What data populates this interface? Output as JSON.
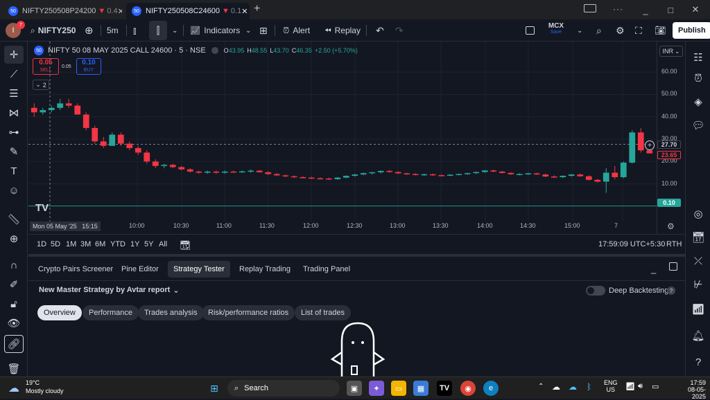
{
  "browser": {
    "tabs": [
      {
        "favicon": "50",
        "title": "NIFTY250508P24200",
        "arrow": "▼",
        "value": "0.4"
      },
      {
        "favicon": "50",
        "title": "NIFTY250508C24600",
        "arrow": "▼",
        "value": "0.1"
      }
    ],
    "new_tab": "+",
    "window_controls": [
      "_",
      "□",
      "✕"
    ]
  },
  "toolbar": {
    "avatar_letter": "I",
    "notification_count": "7",
    "symbol": "NIFTY250",
    "interval": "5m",
    "indicators_label": "Indicators",
    "alert_label": "Alert",
    "replay_label": "Replay",
    "exchange": "MCX",
    "exchange_sub": "Save",
    "publish_label": "Publish"
  },
  "legend": {
    "favicon": "50",
    "title": "NIFTY 50 08 MAY 2025 CALL 24600 · 5 · NSE",
    "ohlc": [
      {
        "k": "O",
        "v": "43.95"
      },
      {
        "k": "H",
        "v": "48.55"
      },
      {
        "k": "L",
        "v": "43.70"
      },
      {
        "k": "C",
        "v": "46.35"
      }
    ],
    "change": "+2.50 (+5.70%)",
    "sell_price": "0.05",
    "sell_label": "SELL",
    "spread": "0.05",
    "buy_price": "0.10",
    "buy_label": "BUY",
    "collapsed_count": "2",
    "currency": "INR"
  },
  "price_scale": {
    "labels": [
      "60.00",
      "50.00",
      "40.00",
      "30.00",
      "20.00",
      "10.00"
    ],
    "current_price": "27.70",
    "red_marker": "23.65",
    "bottom_marker": "0.10"
  },
  "time_axis": {
    "crosshair_label": "Mon 05 May '25   15:15",
    "labels": [
      "10:00",
      "10:30",
      "11:00",
      "11:30",
      "12:00",
      "12:30",
      "13:00",
      "13:30",
      "14:00",
      "14:30",
      "15:00",
      "7"
    ]
  },
  "range_bar": {
    "ranges": [
      "1D",
      "5D",
      "1M",
      "3M",
      "6M",
      "YTD",
      "1Y",
      "5Y",
      "All"
    ],
    "clock": "17:59:09 UTC+5:30",
    "session": "RTH"
  },
  "panel": {
    "tabs": [
      "Crypto Pairs Screener",
      "Pine Editor",
      "Strategy Tester",
      "Replay Trading",
      "Trading Panel"
    ],
    "active_tab": "Strategy Tester",
    "strategy_name": "New Master Strategy by Avtar report",
    "deep_backtesting": "Deep Backtesting",
    "subtabs": [
      "Overview",
      "Performance",
      "Trades analysis",
      "Risk/performance ratios",
      "List of trades"
    ],
    "active_subtab": "Overview"
  },
  "taskbar": {
    "temperature": "19°C",
    "weather": "Mostly cloudy",
    "search_placeholder": "Search",
    "lang": "ENG",
    "region": "US",
    "time": "17:59",
    "date": "08-05-2025"
  },
  "colors": {
    "up": "#26a69a",
    "down": "#f23645",
    "background": "#131722",
    "accent": "#2962ff"
  },
  "chart_data": {
    "type": "candlestick",
    "ylim": [
      0,
      65
    ],
    "candles": [
      {
        "o": 44,
        "h": 46,
        "l": 40,
        "c": 42
      },
      {
        "o": 42,
        "h": 44,
        "l": 41,
        "c": 43
      },
      {
        "o": 43,
        "h": 45,
        "l": 42,
        "c": 44
      },
      {
        "o": 44,
        "h": 48,
        "l": 43,
        "c": 46
      },
      {
        "o": 46,
        "h": 48,
        "l": 44,
        "c": 45
      },
      {
        "o": 45,
        "h": 46,
        "l": 41,
        "c": 41
      },
      {
        "o": 41,
        "h": 42,
        "l": 34,
        "c": 35
      },
      {
        "o": 35,
        "h": 36,
        "l": 28,
        "c": 29
      },
      {
        "o": 29,
        "h": 31,
        "l": 26,
        "c": 27
      },
      {
        "o": 27,
        "h": 33,
        "l": 27,
        "c": 32
      },
      {
        "o": 32,
        "h": 33,
        "l": 27,
        "c": 28
      },
      {
        "o": 28,
        "h": 29,
        "l": 25,
        "c": 26
      },
      {
        "o": 26,
        "h": 27,
        "l": 23,
        "c": 24
      },
      {
        "o": 24,
        "h": 25,
        "l": 19,
        "c": 20
      },
      {
        "o": 20,
        "h": 21,
        "l": 17,
        "c": 18
      },
      {
        "o": 18,
        "h": 19,
        "l": 17,
        "c": 18.5
      },
      {
        "o": 18.5,
        "h": 19,
        "l": 17,
        "c": 17.5
      },
      {
        "o": 17.5,
        "h": 18,
        "l": 16,
        "c": 16.5
      },
      {
        "o": 16.5,
        "h": 17,
        "l": 15,
        "c": 15.5
      },
      {
        "o": 15.5,
        "h": 16,
        "l": 14.5,
        "c": 15
      },
      {
        "o": 15,
        "h": 16,
        "l": 14.5,
        "c": 15.5
      },
      {
        "o": 15.5,
        "h": 16,
        "l": 14.5,
        "c": 15
      },
      {
        "o": 15,
        "h": 16,
        "l": 14.5,
        "c": 15.5
      },
      {
        "o": 15.5,
        "h": 16,
        "l": 15,
        "c": 15.2
      },
      {
        "o": 15.2,
        "h": 16,
        "l": 14.8,
        "c": 15.6
      },
      {
        "o": 15.6,
        "h": 16.5,
        "l": 15,
        "c": 15.9
      },
      {
        "o": 15.9,
        "h": 16.2,
        "l": 15,
        "c": 15.2
      },
      {
        "o": 15.2,
        "h": 15.6,
        "l": 14,
        "c": 14.4
      },
      {
        "o": 14.4,
        "h": 14.8,
        "l": 13.5,
        "c": 13.8
      },
      {
        "o": 13.8,
        "h": 14.2,
        "l": 13,
        "c": 13.4
      },
      {
        "o": 13.4,
        "h": 13.8,
        "l": 12.6,
        "c": 13
      },
      {
        "o": 13,
        "h": 13.5,
        "l": 12.5,
        "c": 12.8
      },
      {
        "o": 12.8,
        "h": 13.2,
        "l": 12.2,
        "c": 12.5
      },
      {
        "o": 12.5,
        "h": 13,
        "l": 12,
        "c": 12.4
      },
      {
        "o": 12.4,
        "h": 12.8,
        "l": 11.8,
        "c": 12.1
      },
      {
        "o": 12.1,
        "h": 13,
        "l": 11.8,
        "c": 12.8
      },
      {
        "o": 12.8,
        "h": 13.8,
        "l": 12.5,
        "c": 13.6
      },
      {
        "o": 13.6,
        "h": 14.5,
        "l": 13.2,
        "c": 14.2
      },
      {
        "o": 14.2,
        "h": 15,
        "l": 13.8,
        "c": 14.8
      },
      {
        "o": 14.8,
        "h": 15.4,
        "l": 14.2,
        "c": 15.2
      },
      {
        "o": 15.2,
        "h": 16,
        "l": 14.6,
        "c": 15.8
      },
      {
        "o": 15.8,
        "h": 16.2,
        "l": 15,
        "c": 15.3
      },
      {
        "o": 15.3,
        "h": 15.6,
        "l": 14.4,
        "c": 14.7
      },
      {
        "o": 14.7,
        "h": 15,
        "l": 14,
        "c": 14.4
      },
      {
        "o": 14.4,
        "h": 14.8,
        "l": 13.8,
        "c": 14.1
      },
      {
        "o": 14.1,
        "h": 14.6,
        "l": 13.6,
        "c": 14.3
      },
      {
        "o": 14.3,
        "h": 14.6,
        "l": 13.6,
        "c": 13.9
      },
      {
        "o": 13.9,
        "h": 14.2,
        "l": 13.4,
        "c": 13.7
      },
      {
        "o": 13.7,
        "h": 14.4,
        "l": 13.4,
        "c": 14.1
      },
      {
        "o": 14.1,
        "h": 14.6,
        "l": 13.8,
        "c": 14.4
      },
      {
        "o": 14.4,
        "h": 15,
        "l": 14,
        "c": 14.8
      },
      {
        "o": 14.8,
        "h": 15.5,
        "l": 14.4,
        "c": 15.3
      },
      {
        "o": 15.3,
        "h": 16.2,
        "l": 15,
        "c": 16
      },
      {
        "o": 16,
        "h": 16.4,
        "l": 15.2,
        "c": 15.5
      },
      {
        "o": 15.5,
        "h": 15.8,
        "l": 14.6,
        "c": 14.9
      },
      {
        "o": 14.9,
        "h": 15.2,
        "l": 14,
        "c": 14.3
      },
      {
        "o": 14.3,
        "h": 14.8,
        "l": 13.8,
        "c": 14.4
      },
      {
        "o": 14.4,
        "h": 15,
        "l": 14,
        "c": 14.7
      },
      {
        "o": 14.7,
        "h": 15,
        "l": 14,
        "c": 14.2
      },
      {
        "o": 14.2,
        "h": 14.6,
        "l": 13,
        "c": 13.3
      },
      {
        "o": 13.3,
        "h": 13.8,
        "l": 12.6,
        "c": 13
      },
      {
        "o": 13,
        "h": 13.8,
        "l": 12.6,
        "c": 13.6
      },
      {
        "o": 13.6,
        "h": 14.4,
        "l": 13.2,
        "c": 14.2
      },
      {
        "o": 14.2,
        "h": 14.6,
        "l": 13.2,
        "c": 13.4
      },
      {
        "o": 13.4,
        "h": 13.8,
        "l": 11.5,
        "c": 11.8
      },
      {
        "o": 11.8,
        "h": 12.2,
        "l": 10.5,
        "c": 11
      },
      {
        "o": 11,
        "h": 17,
        "l": 6,
        "c": 15
      },
      {
        "o": 15,
        "h": 18,
        "l": 12,
        "c": 13
      },
      {
        "o": 13,
        "h": 20,
        "l": 12.5,
        "c": 19.5
      },
      {
        "o": 19.5,
        "h": 34,
        "l": 19,
        "c": 33
      },
      {
        "o": 33,
        "h": 35,
        "l": 24,
        "c": 25
      },
      {
        "o": 25,
        "h": 26,
        "l": 23.5,
        "c": 23.65
      }
    ]
  }
}
